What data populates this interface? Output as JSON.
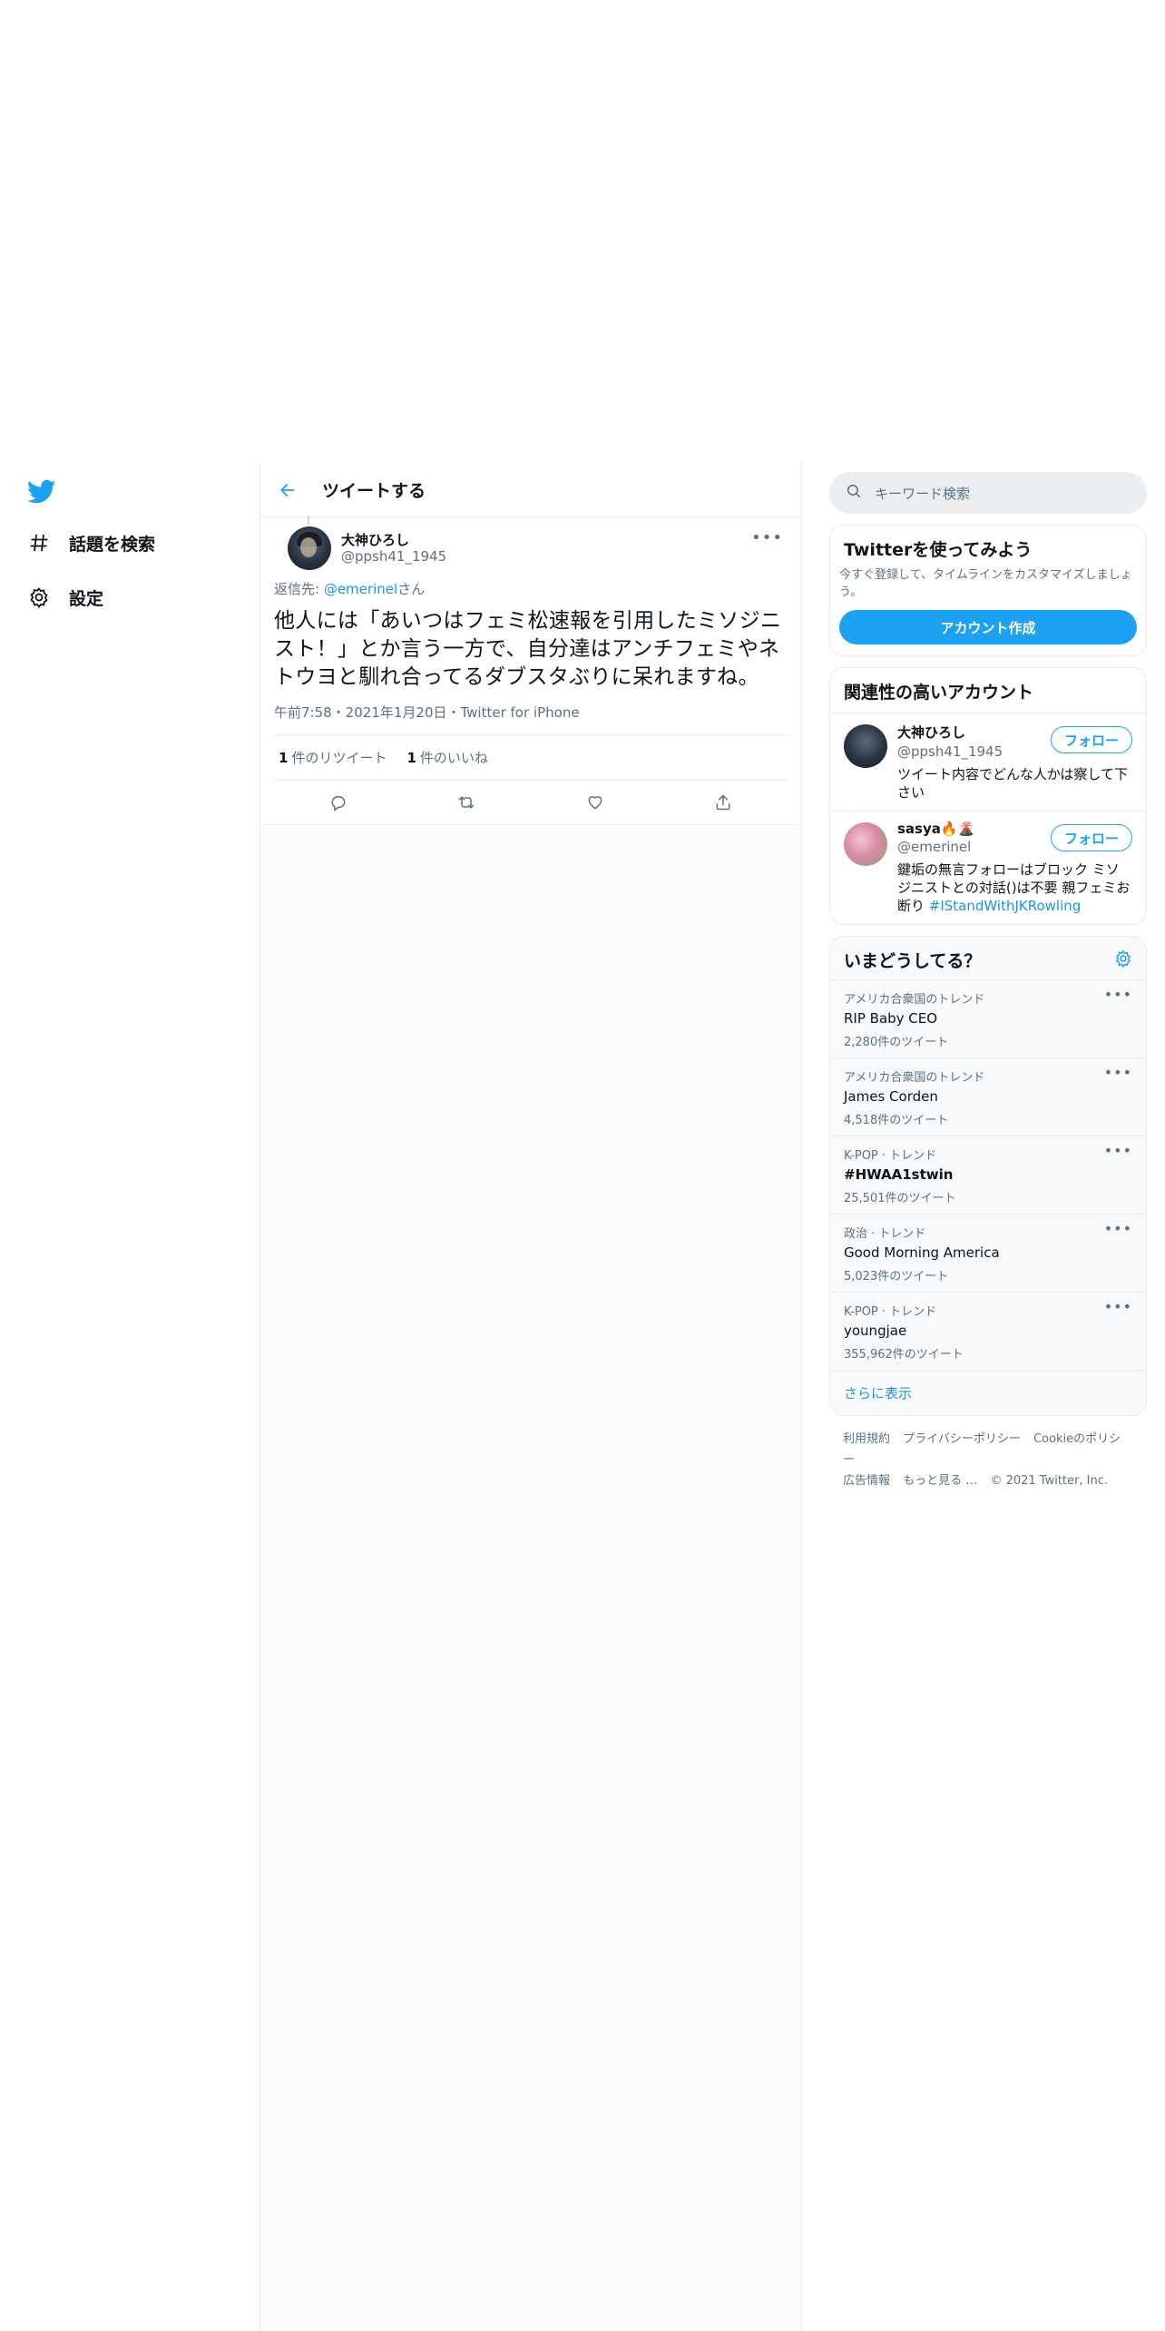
{
  "nav": {
    "items": [
      {
        "label": "話題を検索",
        "icon": "hashtag-icon"
      },
      {
        "label": "設定",
        "icon": "gear-icon"
      }
    ]
  },
  "header": {
    "title": "ツイートする"
  },
  "tweet": {
    "author_name": "大神ひろし",
    "author_handle": "@ppsh41_1945",
    "reply_prefix": "返信先: ",
    "reply_mention": "@emerinel",
    "reply_suffix": "さん",
    "body": "他人には「あいつはフェミ松速報を引用したミソジニスト！」とか言う一方で、自分達はアンチフェミやネトウヨと馴れ合ってるダブスタぶりに呆れますね。",
    "meta": "午前7:58・2021年1月20日・Twitter for iPhone",
    "retweets_count": "1",
    "retweets_label": "件のリツイート",
    "likes_count": "1",
    "likes_label": "件のいいね"
  },
  "search": {
    "placeholder": "キーワード検索"
  },
  "signup": {
    "title": "Twitterを使ってみよう",
    "subtitle": "今すぐ登録して、タイムラインをカスタマイズしましょう。",
    "button": "アカウント作成"
  },
  "relevant": {
    "title": "関連性の高いアカウント",
    "accounts": [
      {
        "name": "大神ひろし",
        "handle": "@ppsh41_1945",
        "bio": "ツイート内容でどんな人かは察して下さい",
        "bio_tag": "",
        "follow": "フォロー"
      },
      {
        "name": "sasya🔥🌋",
        "handle": "@emerinel",
        "bio": "鍵垢の無言フォローはブロック ミソジニストとの対話()は不要 親フェミお断り ",
        "bio_tag": "#IStandWithJKRowling",
        "follow": "フォロー"
      }
    ]
  },
  "trends": {
    "title": "いまどうしてる？",
    "items": [
      {
        "context": "アメリカ合衆国のトレンド",
        "name": "RIP Baby CEO",
        "count": "2,280件のツイート"
      },
      {
        "context": "アメリカ合衆国のトレンド",
        "name": "James Corden",
        "count": "4,518件のツイート"
      },
      {
        "context": "K-POP · トレンド",
        "name": "#HWAA1stwin",
        "count": "25,501件のツイート"
      },
      {
        "context": "政治 · トレンド",
        "name": "Good Morning America",
        "count": "5,023件のツイート"
      },
      {
        "context": "K-POP · トレンド",
        "name": "youngjae",
        "count": "355,962件のツイート"
      }
    ],
    "show_more": "さらに表示"
  },
  "footer": {
    "links": [
      "利用規約",
      "プライバシーポリシー",
      "Cookieのポリシー",
      "広告情報",
      "もっと見る …",
      "© 2021 Twitter, Inc."
    ]
  },
  "colors": {
    "accent": "#1da1f2",
    "link": "#1b95e0",
    "muted": "#5b7083",
    "border": "#e6ecf0"
  }
}
